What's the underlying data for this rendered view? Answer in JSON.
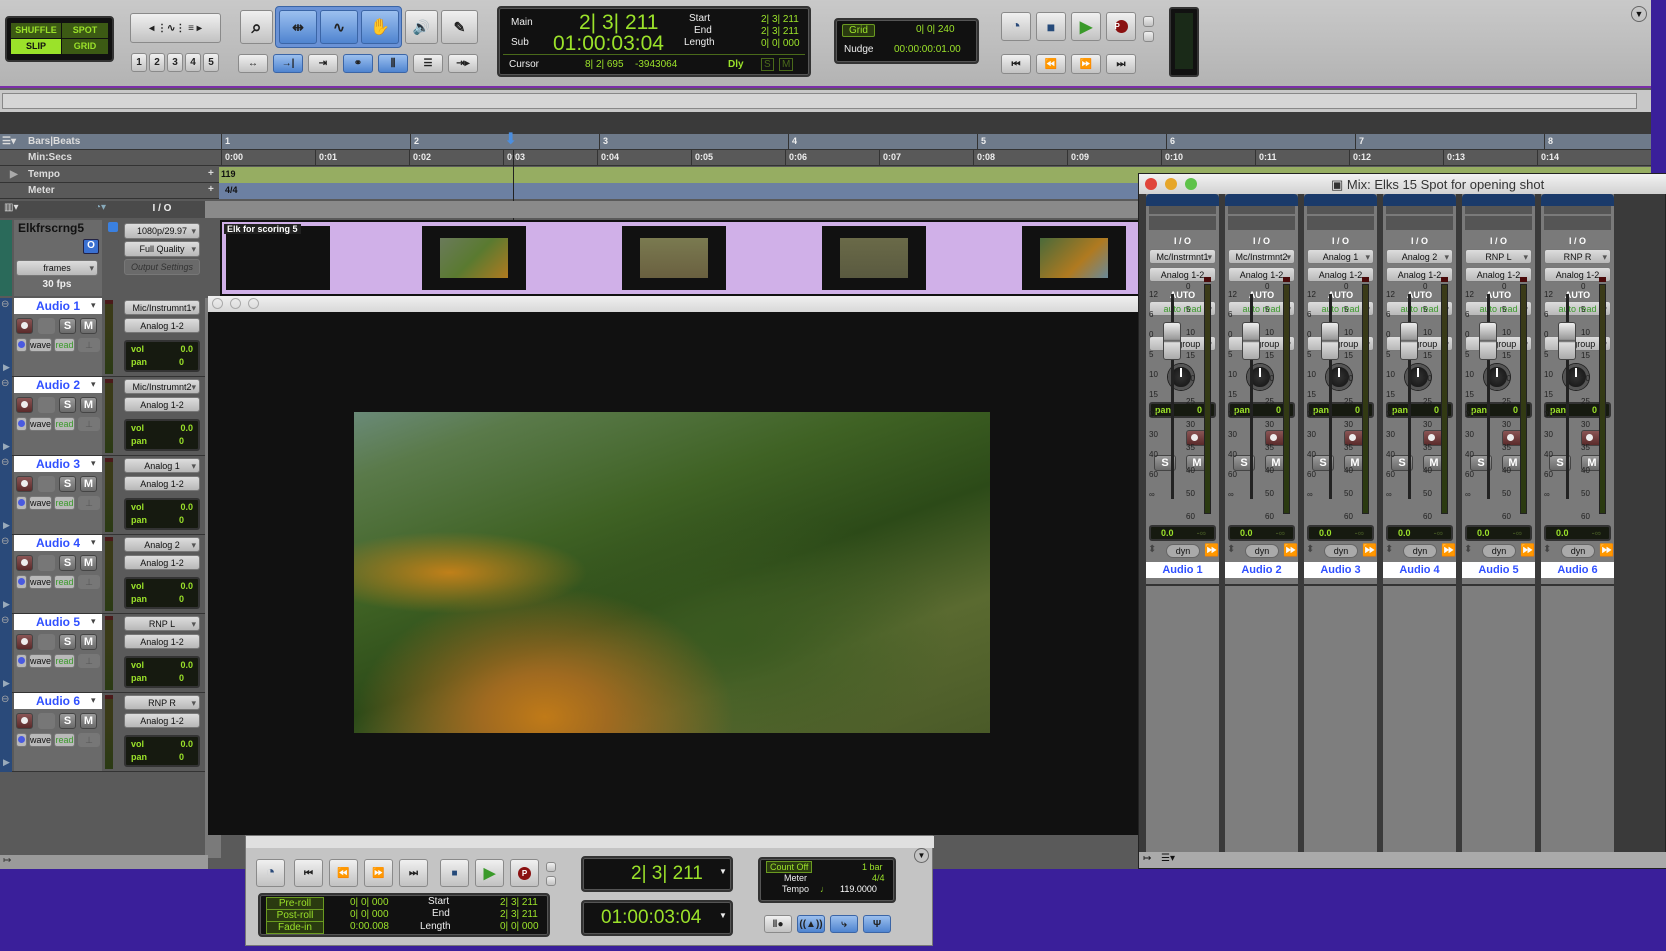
{
  "toolbar": {
    "edit_modes": [
      "SHUFFLE",
      "SPOT",
      "SLIP",
      "GRID"
    ],
    "zoom_presets": [
      "1",
      "2",
      "3",
      "4",
      "5"
    ],
    "counter": {
      "main_label": "Main",
      "main_value": "2| 3| 211",
      "sub_label": "Sub",
      "sub_value": "01:00:03:04",
      "start_label": "Start",
      "start_value": "2| 3| 211",
      "end_label": "End",
      "end_value": "2| 3| 211",
      "length_label": "Length",
      "length_value": "0| 0| 000",
      "cursor_label": "Cursor",
      "cursor_value": "8| 2| 695",
      "sample_value": "-3943064",
      "dly_label": "Dly",
      "s_label": "S",
      "m_label": "M"
    },
    "grid": {
      "grid_label": "Grid",
      "grid_value": "0| 0| 240",
      "nudge_label": "Nudge",
      "nudge_value": "00:00:00:01.00"
    }
  },
  "ruler": {
    "rows": [
      "Bars|Beats",
      "Min:Secs",
      "Tempo",
      "Meter"
    ],
    "bars": [
      "1",
      "2",
      "3",
      "4",
      "5",
      "6",
      "7",
      "8"
    ],
    "secs": [
      "0:00",
      "0:01",
      "0:02",
      "0:03",
      "0:04",
      "0:05",
      "0:06",
      "0:07",
      "0:08",
      "0:09",
      "0:10",
      "0:11",
      "0:12",
      "0:13",
      "0:14"
    ],
    "tempo_value": "119",
    "meter_value": "4/4"
  },
  "header": {
    "io_label": "I / O"
  },
  "video_track": {
    "name": "Elkfrscrng5",
    "format": "1080p/29.97",
    "quality": "Full Quality",
    "output": "Output Settings",
    "o_button": "O",
    "timebase": "frames",
    "fps": "30 fps",
    "clip_name": "Elk for scoring 5"
  },
  "tracks": [
    {
      "name": "Audio 1",
      "input": "Mic/Instrumnt1",
      "output": "Analog 1-2"
    },
    {
      "name": "Audio 2",
      "input": "Mic/Instrumnt2",
      "output": "Analog 1-2"
    },
    {
      "name": "Audio 3",
      "input": "Analog 1",
      "output": "Analog 1-2"
    },
    {
      "name": "Audio 4",
      "input": "Analog 2",
      "output": "Analog 1-2"
    },
    {
      "name": "Audio 5",
      "input": "RNP L",
      "output": "Analog 1-2"
    },
    {
      "name": "Audio 6",
      "input": "RNP R",
      "output": "Analog 1-2"
    }
  ],
  "track_common": {
    "s": "S",
    "m": "M",
    "view": "wave",
    "auto": "read",
    "vol_label": "vol",
    "vol_value": "0.0",
    "pan_label": "pan",
    "pan_value": "0"
  },
  "mixer": {
    "title": "Mix: Elks 15 Spot for opening shot",
    "strips": [
      {
        "name": "Audio 1",
        "input": "Mc/Instrmnt1",
        "output": "Analog 1-2"
      },
      {
        "name": "Audio 2",
        "input": "Mc/Instrmnt2",
        "output": "Analog 1-2"
      },
      {
        "name": "Audio 3",
        "input": "Analog 1",
        "output": "Analog 1-2"
      },
      {
        "name": "Audio 4",
        "input": "Analog 2",
        "output": "Analog 1-2"
      },
      {
        "name": "Audio 5",
        "input": "RNP L",
        "output": "Analog 1-2"
      },
      {
        "name": "Audio 6",
        "input": "RNP R",
        "output": "Analog 1-2"
      }
    ],
    "common": {
      "io": "I / O",
      "auto": "AUTO",
      "auto_mode": "auto read",
      "group": "no group",
      "pan": "pan",
      "pan_value": "0",
      "s": "S",
      "m": "M",
      "vol": "0.0",
      "peak": "-∞",
      "dyn": "dyn"
    },
    "fader_scale": [
      "12",
      "6",
      "0",
      "5",
      "10",
      "15",
      "20",
      "30",
      "40",
      "60",
      "∞"
    ],
    "meter_scale": [
      "0",
      "5",
      "10",
      "15",
      "20",
      "25",
      "30",
      "35",
      "40",
      "50",
      "60"
    ]
  },
  "transport": {
    "main_counter": "2| 3| 211",
    "sub_counter": "01:00:03:04",
    "preroll_label": "Pre-roll",
    "preroll_value": "0| 0| 000",
    "postroll_label": "Post-roll",
    "postroll_value": "0| 0| 000",
    "fadein_label": "Fade-in",
    "fadein_value": "0:00.008",
    "start_label": "Start",
    "start_value": "2| 3| 211",
    "end_label": "End",
    "end_value": "2| 3| 211",
    "length_label": "Length",
    "length_value": "0| 0| 000",
    "countoff_label": "Count Off",
    "countoff_value": "1 bar",
    "meter_label": "Meter",
    "meter_value": "4/4",
    "tempo_label": "Tempo",
    "tempo_value": "119.0000"
  }
}
